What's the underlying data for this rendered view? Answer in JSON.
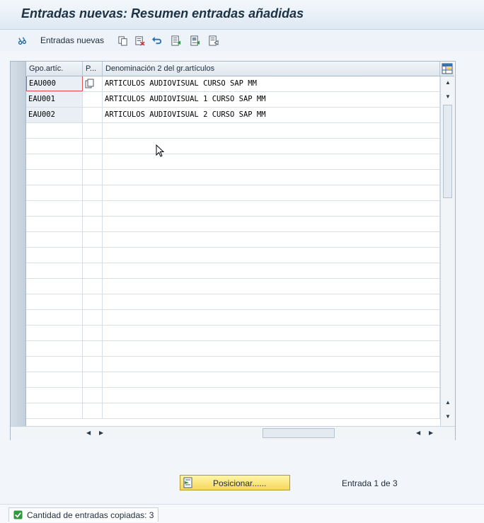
{
  "window": {
    "title": "Entradas nuevas: Resumen entradas añadidas"
  },
  "toolbar": {
    "new_entries_label": "Entradas nuevas",
    "icons": [
      "glasses-icon",
      "copy-icon",
      "delete-icon",
      "undo-icon",
      "select-all-icon",
      "select-block-icon",
      "deselect-all-icon"
    ]
  },
  "table": {
    "columns": [
      "Gpo.artíc.",
      "P...",
      "Denominación 2 del gr.artículos"
    ],
    "rows": [
      {
        "key": "EAU000",
        "desc": "ARTICULOS AUDIOVISUAL CURSO SAP MM"
      },
      {
        "key": "EAU001",
        "desc": "ARTICULOS AUDIOVISUAL 1 CURSO SAP MM"
      },
      {
        "key": "EAU002",
        "desc": "ARTICULOS AUDIOVISUAL 2 CURSO SAP MM"
      }
    ]
  },
  "position_button": {
    "label": "Posicionar......"
  },
  "entry_info": "Entrada 1 de 3",
  "status_bar": {
    "message": "Cantidad de entradas copiadas: 3",
    "status_color": "#2e9a3c"
  }
}
